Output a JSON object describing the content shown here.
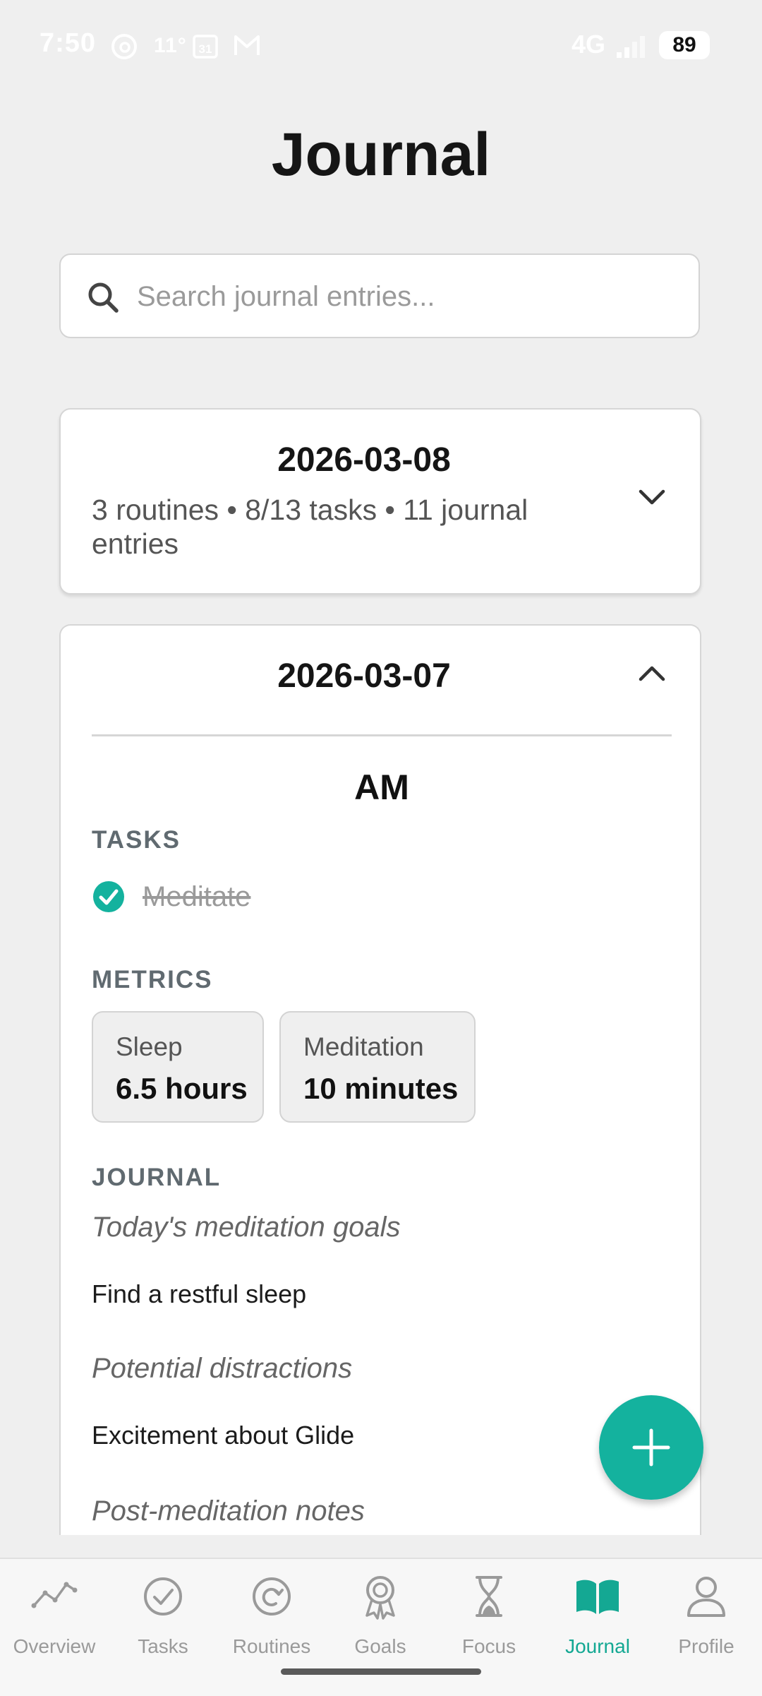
{
  "status_bar": {
    "time": "7:50",
    "temperature": "11°",
    "calendar_day": "31",
    "network": "4G",
    "battery": "89"
  },
  "page": {
    "title": "Journal"
  },
  "search": {
    "placeholder": "Search journal entries..."
  },
  "days": [
    {
      "date": "2026-03-08",
      "summary": "3 routines • 8/13 tasks • 11 journal entries",
      "expanded": false
    },
    {
      "date": "2026-03-07",
      "expanded": true,
      "section": "AM",
      "tasks_label": "TASKS",
      "tasks": [
        {
          "label": "Meditate",
          "done": true
        }
      ],
      "metrics_label": "METRICS",
      "metrics": [
        {
          "label": "Sleep",
          "value": "6.5 hours"
        },
        {
          "label": "Meditation",
          "value": "10 minutes"
        }
      ],
      "journal_label": "JOURNAL",
      "journal": [
        {
          "question": "Today's meditation goals",
          "answer": "Find a restful sleep"
        },
        {
          "question": "Potential distractions",
          "answer": "Excitement about Glide"
        },
        {
          "question": "Post-meditation notes",
          "answer": ""
        }
      ]
    }
  ],
  "fab": {
    "icon": "plus-icon"
  },
  "nav": {
    "active": "Journal",
    "items": [
      {
        "label": "Overview",
        "icon": "trend-line-icon"
      },
      {
        "label": "Tasks",
        "icon": "check-circle-icon"
      },
      {
        "label": "Routines",
        "icon": "refresh-circle-icon"
      },
      {
        "label": "Goals",
        "icon": "award-ribbon-icon"
      },
      {
        "label": "Focus",
        "icon": "hourglass-icon"
      },
      {
        "label": "Journal",
        "icon": "open-book-icon"
      },
      {
        "label": "Profile",
        "icon": "user-icon"
      }
    ]
  },
  "colors": {
    "accent": "#14b29e",
    "background": "#efefef",
    "card": "#ffffff",
    "muted_text": "#9a9a9a"
  }
}
